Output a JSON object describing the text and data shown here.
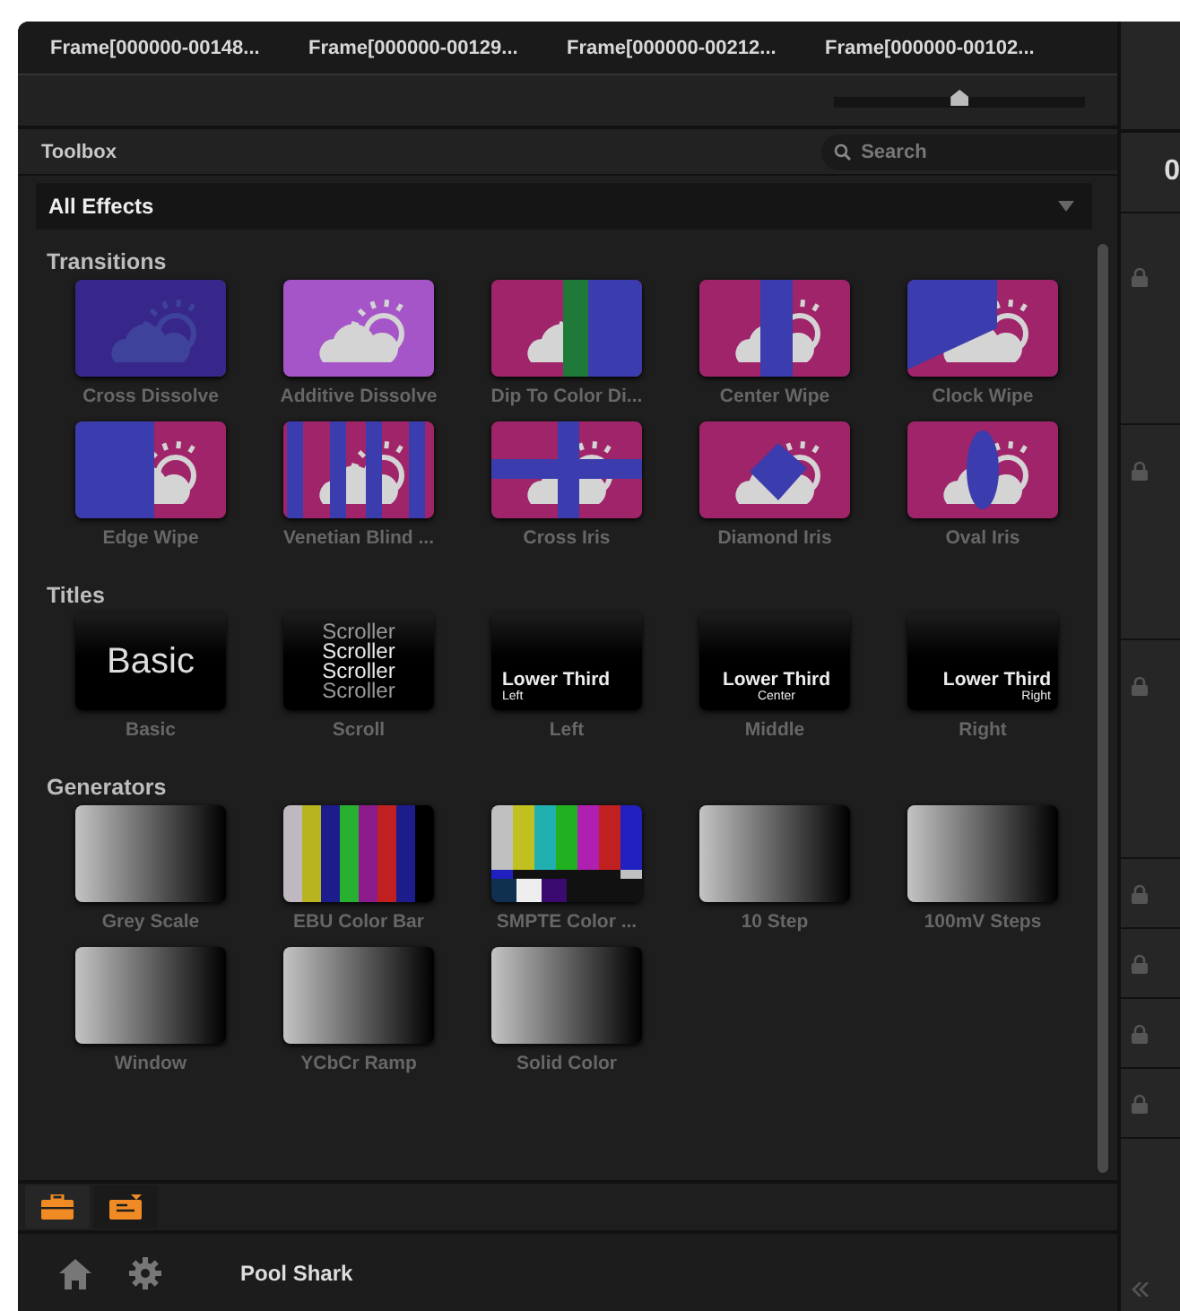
{
  "clips": [
    "Frame[000000-00148...",
    "Frame[000000-00129...",
    "Frame[000000-00212...",
    "Frame[000000-00102..."
  ],
  "zoom_slider": {
    "level": 0.5
  },
  "toolbox": {
    "title": "Toolbox",
    "search": {
      "placeholder": "Search"
    },
    "filter": {
      "value": "All Effects"
    }
  },
  "sections": [
    {
      "title": "Transitions",
      "items": [
        {
          "label": "Cross Dissolve",
          "kind": "cross-dissolve"
        },
        {
          "label": "Additive Dissolve",
          "kind": "additive"
        },
        {
          "label": "Dip To Color Di...",
          "kind": "dip"
        },
        {
          "label": "Center Wipe",
          "kind": "center-wipe"
        },
        {
          "label": "Clock Wipe",
          "kind": "clock-wipe"
        },
        {
          "label": "Edge Wipe",
          "kind": "edge-wipe"
        },
        {
          "label": "Venetian Blind ...",
          "kind": "venetian"
        },
        {
          "label": "Cross Iris",
          "kind": "cross-iris"
        },
        {
          "label": "Diamond Iris",
          "kind": "diamond-iris"
        },
        {
          "label": "Oval Iris",
          "kind": "oval-iris"
        }
      ]
    },
    {
      "title": "Titles",
      "items": [
        {
          "label": "Basic",
          "kind": "basic",
          "preview": [
            "Basic"
          ]
        },
        {
          "label": "Scroll",
          "kind": "scroll",
          "preview": [
            "Scroller",
            "Scroller",
            "Scroller",
            "Scroller"
          ]
        },
        {
          "label": "Left",
          "kind": "lower-left",
          "preview": [
            "Lower Third",
            "Left"
          ]
        },
        {
          "label": "Middle",
          "kind": "lower-center",
          "preview": [
            "Lower Third",
            "Center"
          ]
        },
        {
          "label": "Right",
          "kind": "lower-right",
          "preview": [
            "Lower Third",
            "Right"
          ]
        }
      ]
    },
    {
      "title": "Generators",
      "items": [
        {
          "label": "Grey Scale",
          "kind": "gradient"
        },
        {
          "label": "EBU Color Bar",
          "kind": "ebu"
        },
        {
          "label": "SMPTE Color ...",
          "kind": "smpte"
        },
        {
          "label": "10 Step",
          "kind": "gradient"
        },
        {
          "label": "100mV Steps",
          "kind": "gradient"
        },
        {
          "label": "Window",
          "kind": "gradient"
        },
        {
          "label": "YCbCr Ramp",
          "kind": "gradient"
        },
        {
          "label": "Solid Color",
          "kind": "gradient"
        }
      ]
    }
  ],
  "bottom_tabs": [
    {
      "kind": "toolbox",
      "selected": true
    },
    {
      "kind": "media",
      "selected": false
    }
  ],
  "footer": {
    "project": "Pool Shark"
  },
  "side_strip": {
    "value": "0"
  }
}
